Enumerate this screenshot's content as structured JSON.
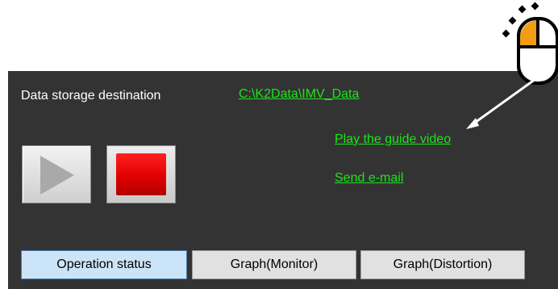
{
  "storage": {
    "label": "Data storage destination",
    "path": "C:\\K2Data\\IMV_Data"
  },
  "links": {
    "guide_video": "Play the guide video",
    "send_email": "Send e-mail"
  },
  "controls": {
    "play_icon": "play-icon",
    "stop_icon": "stop-icon"
  },
  "tabs": [
    {
      "label": "Operation status",
      "active": true
    },
    {
      "label": "Graph(Monitor)",
      "active": false
    },
    {
      "label": "Graph(Distortion)",
      "active": false
    }
  ],
  "colors": {
    "panel_bg": "#333333",
    "link": "#19e619",
    "stop_red": "#e00000",
    "active_tab": "#cce4f7",
    "mouse_highlight": "#f39c12"
  }
}
